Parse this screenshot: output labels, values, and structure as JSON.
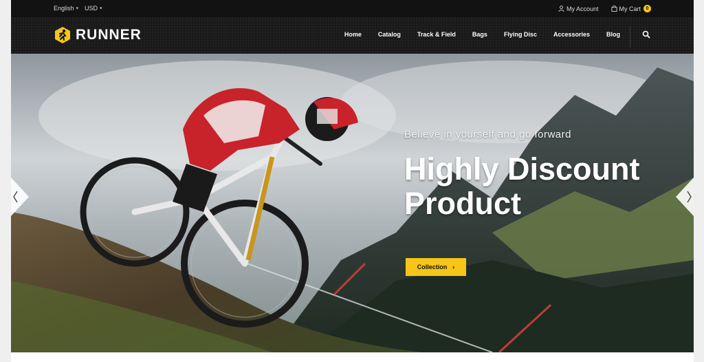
{
  "topbar": {
    "language": "English",
    "currency": "USD",
    "account_label": "My Account",
    "cart_label": "My Cart",
    "cart_count": "0"
  },
  "brand": {
    "name": "RUNNER",
    "accent": "#f5c518"
  },
  "nav": {
    "items": [
      "Home",
      "Catalog",
      "Track & Field",
      "Bags",
      "Flying Disc",
      "Accessories",
      "Blog"
    ]
  },
  "hero": {
    "tagline": "Believe in yourself and go forward",
    "headline": "Highly Discount Product",
    "cta_label": "Collection"
  },
  "icons": {
    "account": "user-icon",
    "cart": "bag-icon",
    "search": "search-icon",
    "prev": "chevron-left-icon",
    "next": "chevron-right-icon"
  }
}
